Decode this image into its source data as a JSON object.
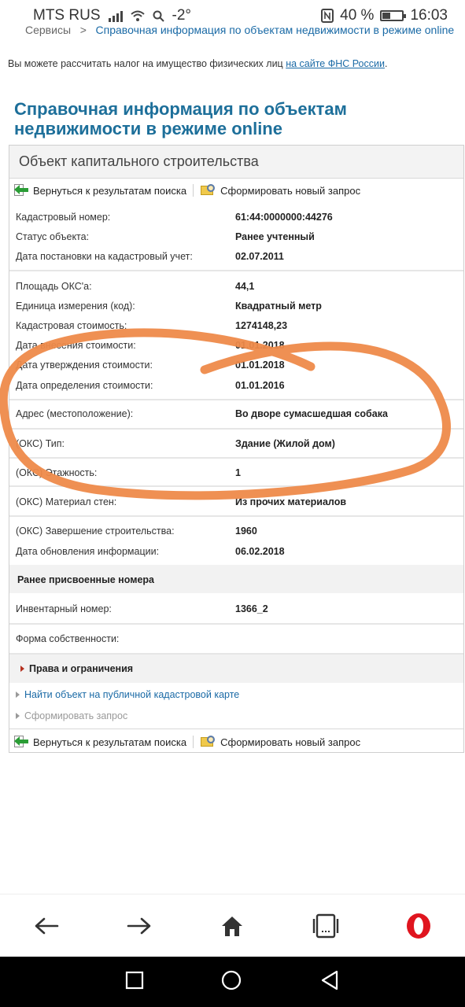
{
  "status_bar": {
    "carrier": "MTS RUS",
    "temperature": "-2°",
    "battery_percent": "40 %",
    "battery_level": 0.4,
    "time": "16:03"
  },
  "breadcrumb": {
    "item1": "Сервисы",
    "separator": ">",
    "current": "Справочная информация по объектам недвижимости в режиме online"
  },
  "tax_note": {
    "text": "Вы можете рассчитать налог на имущество физических лиц ",
    "link": "на сайте ФНС России",
    "suffix": "."
  },
  "page_title": "Справочная информация по объектам недвижимости в режиме online",
  "card": {
    "header": "Объект капитального строительства",
    "toolbar": {
      "back": "Вернуться к результатам поиска",
      "new_request": "Сформировать новый запрос"
    },
    "fields": [
      {
        "label": "Кадастровый номер:",
        "value": "61:44:0000000:44276"
      },
      {
        "label": "Статус объекта:",
        "value": "Ранее учтенный"
      },
      {
        "label": "Дата постановки на кадастровый учет:",
        "value": "02.07.2011"
      },
      {
        "label": "Площадь ОКС'а:",
        "value": "44,1"
      },
      {
        "label": "Единица измерения (код):",
        "value": "Квадратный метр"
      },
      {
        "label": "Кадастровая стоимость:",
        "value": "1274148,23"
      },
      {
        "label": "Дата внесения стоимости:",
        "value": "01.01.2018"
      },
      {
        "label": "Дата утверждения стоимости:",
        "value": "01.01.2018"
      },
      {
        "label": "Дата определения стоимости:",
        "value": "01.01.2016"
      },
      {
        "label": "Адрес (местоположение):",
        "value": "Во дворе сумасшедшая собака"
      },
      {
        "label": "(ОКС) Тип:",
        "value": "Здание (Жилой дом)"
      },
      {
        "label": "(ОКС) Этажность:",
        "value": "1"
      },
      {
        "label": "(ОКС) Материал стен:",
        "value": "Из прочих материалов"
      },
      {
        "label": "(ОКС) Завершение строительства:",
        "value": "1960"
      },
      {
        "label": "Дата обновления информации:",
        "value": "06.02.2018"
      }
    ],
    "prev_numbers_title": "Ранее присвоенные номера",
    "inventory": {
      "label": "Инвентарный номер:",
      "value": "1366_2"
    },
    "ownership_label": "Форма собственности:",
    "rights": "Права и ограничения",
    "map_link": "Найти объект на публичной кадастровой карте",
    "request_link": "Сформировать запрос"
  },
  "colors": {
    "title_blue": "#1d6f9a",
    "link_blue": "#1a6aa6",
    "scribble_orange": "#ee8a4a",
    "opera_red": "#e0151f"
  },
  "icons": [
    "back-arrow-icon",
    "forward-arrow-icon",
    "home-icon",
    "tabs-icon",
    "opera-icon",
    "square-icon",
    "circle-icon",
    "triangle-back-icon"
  ]
}
